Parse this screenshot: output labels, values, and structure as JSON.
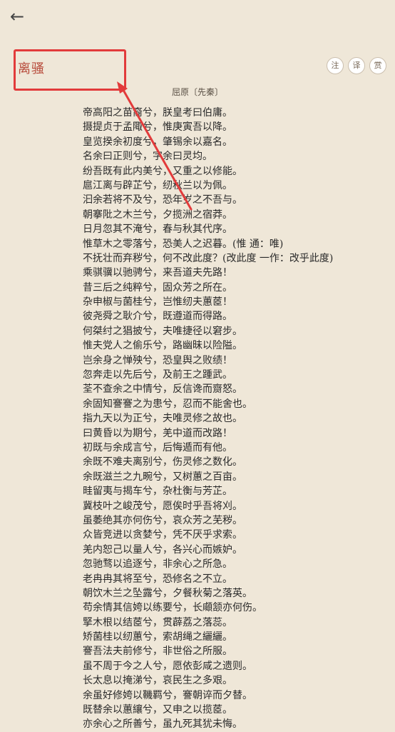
{
  "header": {
    "back_icon": "←"
  },
  "page": {
    "title": "离骚",
    "author": "屈原〔先秦〕"
  },
  "tools": [
    {
      "name": "annotation-button",
      "label": "注"
    },
    {
      "name": "translation-button",
      "label": "译"
    },
    {
      "name": "appreciation-button",
      "label": "赏"
    }
  ],
  "poem": {
    "lines": [
      "帝高阳之苗裔兮，朕皇考曰伯庸。",
      "摄提贞于孟陬兮，惟庚寅吾以降。",
      "皇览揆余初度兮，肇锡余以嘉名。",
      "名余曰正则兮，字余曰灵均。",
      "纷吾既有此内美兮，又重之以修能。",
      "扈江离与辟芷兮，纫秋兰以为佩。",
      "汩余若将不及兮，恐年岁之不吾与。",
      "朝搴阰之木兰兮，夕揽洲之宿莽。",
      "日月忽其不淹兮，春与秋其代序。",
      "惟草木之零落兮，恐美人之迟暮。(惟 通：唯)",
      "不抚壮而弃秽兮，何不改此度？(改此度 一作：改乎此度)",
      "乘骐骥以驰骋兮，来吾道夫先路！",
      "昔三后之纯粹兮，固众芳之所在。",
      "杂申椒与菌桂兮，岂惟纫夫蕙茝！",
      "彼尧舜之耿介兮，既遵道而得路。",
      "何桀纣之猖披兮，夫唯捷径以窘步。",
      "惟夫党人之偷乐兮，路幽昧以险隘。",
      "岂余身之惮殃兮，恐皇舆之败绩！",
      "忽奔走以先后兮，及前王之踵武。",
      "荃不查余之中情兮，反信谗而齌怒。",
      "余固知謇謇之为患兮，忍而不能舍也。",
      "指九天以为正兮，夫唯灵修之故也。",
      "曰黄昏以为期兮，羌中道而改路！",
      "初既与余成言兮，后悔遁而有他。",
      "余既不难夫离别兮，伤灵修之数化。",
      "余既滋兰之九畹兮，又树蕙之百亩。",
      "畦留夷与揭车兮，杂杜衡与芳芷。",
      "冀枝叶之峻茂兮，愿俟时乎吾将刈。",
      "虽萎绝其亦何伤兮，哀众芳之芜秽。",
      "众皆竞进以贪婪兮，凭不厌乎求索。",
      "羌内恕己以量人兮，各兴心而嫉妒。",
      "忽驰骛以追逐兮，非余心之所急。",
      "老冉冉其将至兮，恐修名之不立。",
      "朝饮木兰之坠露兮，夕餐秋菊之落英。",
      "苟余情其信姱以练要兮，长顑颔亦何伤。",
      "掔木根以结茝兮，贯薜荔之落蕊。",
      "矫菌桂以纫蕙兮，索胡绳之纚纚。",
      "謇吾法夫前修兮，非世俗之所服。",
      "虽不周于今之人兮，愿依彭咸之遗则。",
      "长太息以掩涕兮，哀民生之多艰。",
      "余虽好修姱以鞿羁兮，謇朝谇而夕替。",
      "既替余以蕙纕兮，又申之以揽茝。",
      "亦余心之所善兮，虽九死其犹未悔。"
    ]
  },
  "colors": {
    "background": "#efe7d8",
    "title": "#b74a3a",
    "highlight": "#e23b3b",
    "text": "#2a2a2a"
  }
}
